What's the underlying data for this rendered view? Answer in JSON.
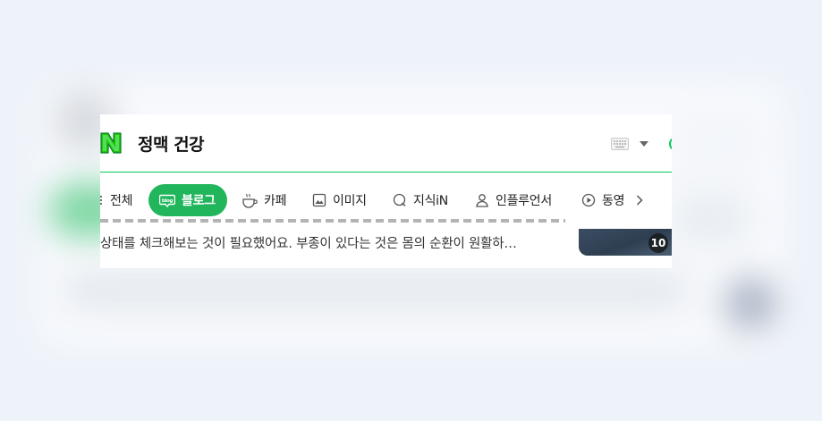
{
  "search": {
    "query": "정맥 건강"
  },
  "tabs": [
    {
      "label": "전체",
      "icon": "list-icon"
    },
    {
      "label": "블로그",
      "icon": "blog-icon",
      "active": true
    },
    {
      "label": "카페",
      "icon": "cafe-icon"
    },
    {
      "label": "이미지",
      "icon": "image-icon"
    },
    {
      "label": "지식iN",
      "icon": "kin-icon"
    },
    {
      "label": "인플루언서",
      "icon": "influencer-icon"
    },
    {
      "label": "동영",
      "icon": "video-icon"
    }
  ],
  "result": {
    "snippet": "상태를 체크해보는 것이 필요했어요. 부종이 있다는 것은 몸의 순환이 원활하…",
    "thumbnail_count": "10"
  },
  "colors": {
    "brand_green": "#03c75a",
    "active_tab": "#21b65c"
  }
}
